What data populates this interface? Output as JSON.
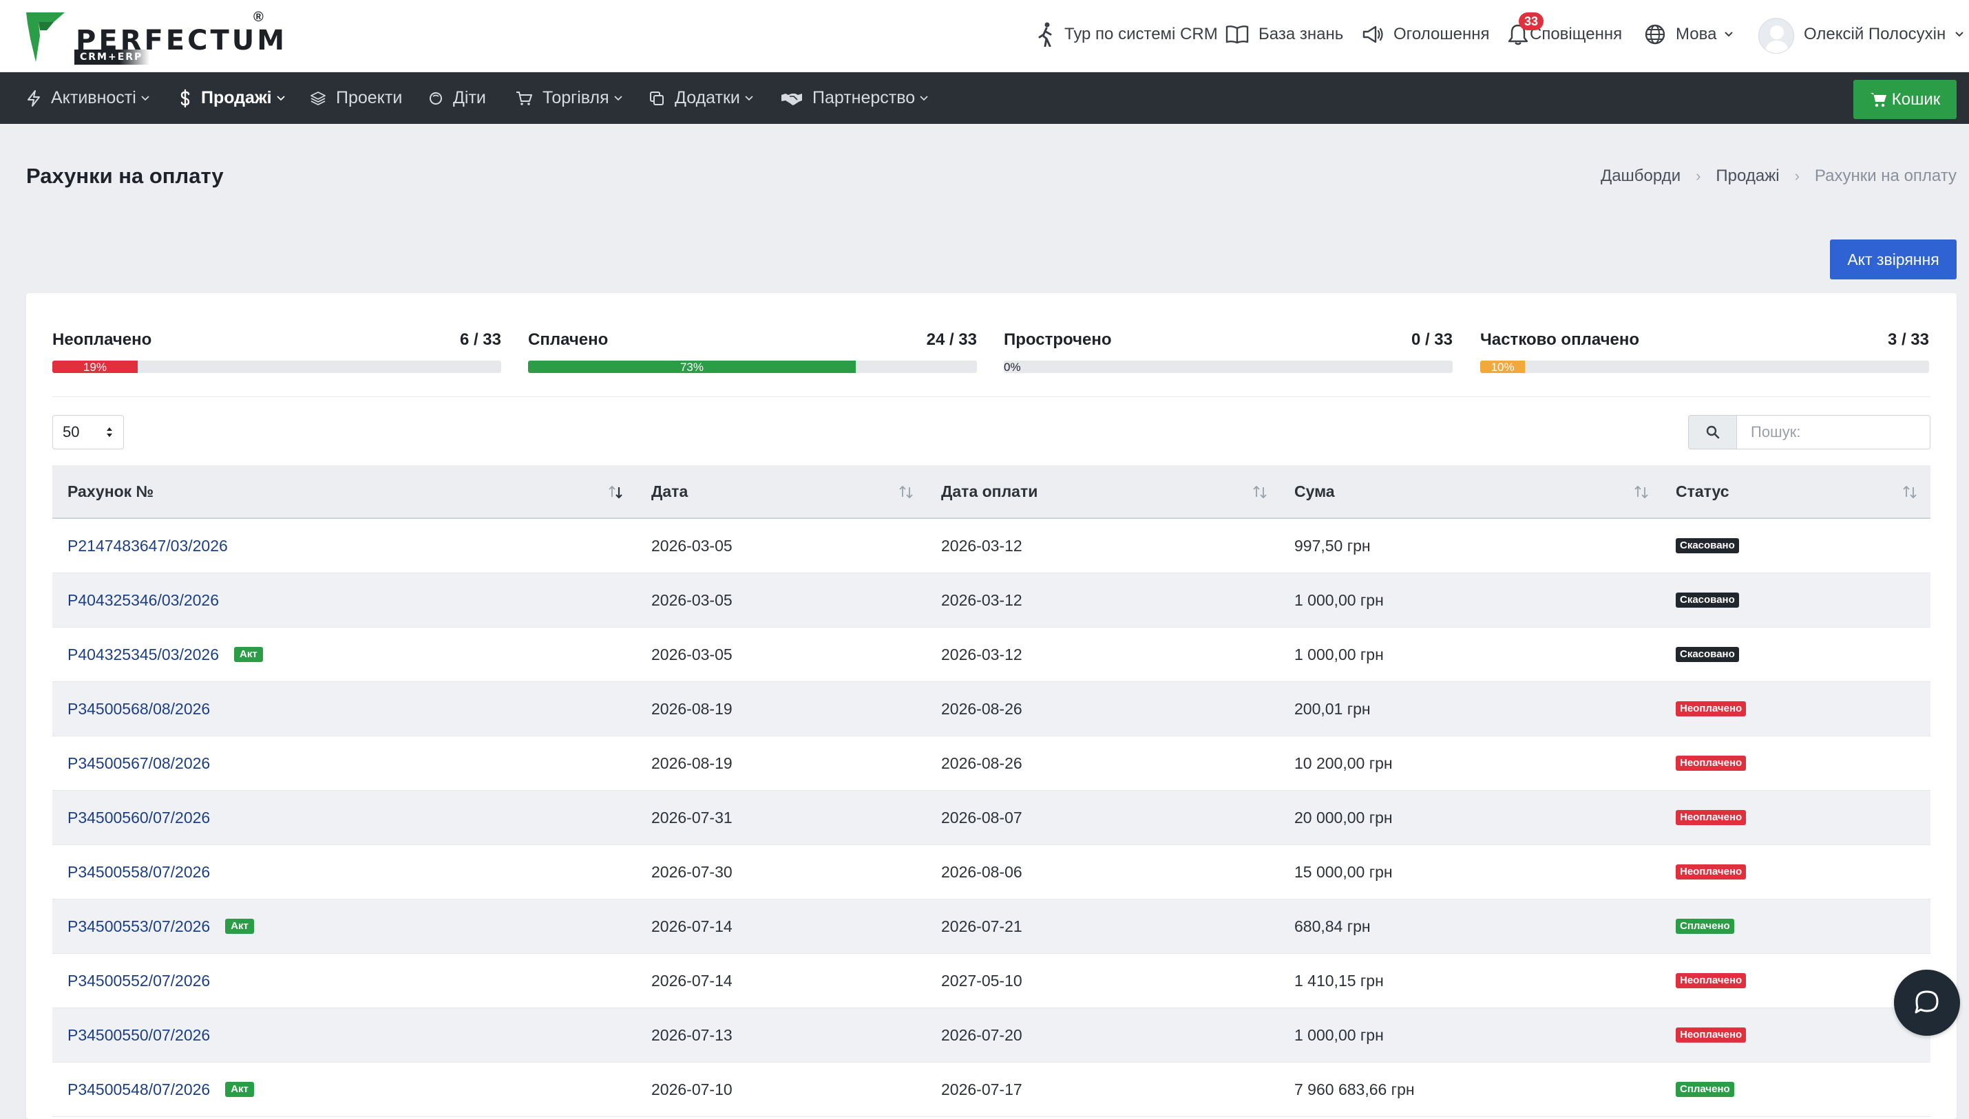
{
  "brand": {
    "name": "PERFECTUM",
    "sub": "CRM+ERP",
    "reg": "®",
    "accent": "#2a9d46"
  },
  "topnav": {
    "tour": "Тур по системі CRM",
    "knowledge": "База знань",
    "announcements": "Оголошення",
    "notifications": "Сповіщення",
    "notifications_count": "33",
    "language": "Мова",
    "user": "Олексій Полосухін"
  },
  "mainnav": {
    "items": [
      {
        "label": "Активності",
        "icon": "lightning-icon"
      },
      {
        "label": "Продажі",
        "icon": "dollar-icon"
      },
      {
        "label": "Проекти",
        "icon": "layers-icon"
      },
      {
        "label": "Діти",
        "icon": "circle-icon"
      },
      {
        "label": "Торгівля",
        "icon": "cart-icon"
      },
      {
        "label": "Додатки",
        "icon": "copy-icon"
      },
      {
        "label": "Партнерство",
        "icon": "handshake-icon"
      }
    ],
    "cart": "Кошик"
  },
  "page": {
    "title": "Рахунки на оплату",
    "breadcrumb": [
      "Дашборди",
      "Продажі",
      "Рахунки на оплату"
    ],
    "act_button": "Акт звіряння"
  },
  "stats": [
    {
      "label": "Неоплачено",
      "count": "6 / 33",
      "percent": 19,
      "percent_label": "19%",
      "color": "#e0303e"
    },
    {
      "label": "Сплачено",
      "count": "24 / 33",
      "percent": 73,
      "percent_label": "73%",
      "color": "#2a9d46"
    },
    {
      "label": "Прострочено",
      "count": "0 / 33",
      "percent": 0,
      "percent_label": "0%",
      "color": "#e0303e"
    },
    {
      "label": "Частково оплачено",
      "count": "3 / 33",
      "percent": 10,
      "percent_label": "10%",
      "color": "#f2a83b"
    }
  ],
  "controls": {
    "page_size": "50",
    "search_placeholder": "Пошук:"
  },
  "table": {
    "columns": [
      "Рахунок №",
      "Дата",
      "Дата оплати",
      "Сума",
      "Статус"
    ],
    "act_badge": "Акт",
    "status_colors": {
      "Скасовано": "#22272d",
      "Неоплачено": "#e0303e",
      "Сплачено": "#2a9d46"
    },
    "rows": [
      {
        "number": "Р2147483647/03/2026",
        "date": "2026-03-05",
        "pay_date": "2026-03-12",
        "sum": "997,50 грн",
        "status": "Скасовано",
        "act": false
      },
      {
        "number": "Р404325346/03/2026",
        "date": "2026-03-05",
        "pay_date": "2026-03-12",
        "sum": "1 000,00 грн",
        "status": "Скасовано",
        "act": false
      },
      {
        "number": "Р404325345/03/2026",
        "date": "2026-03-05",
        "pay_date": "2026-03-12",
        "sum": "1 000,00 грн",
        "status": "Скасовано",
        "act": true
      },
      {
        "number": "Р34500568/08/2026",
        "date": "2026-08-19",
        "pay_date": "2026-08-26",
        "sum": "200,01 грн",
        "status": "Неоплачено",
        "act": false
      },
      {
        "number": "Р34500567/08/2026",
        "date": "2026-08-19",
        "pay_date": "2026-08-26",
        "sum": "10 200,00 грн",
        "status": "Неоплачено",
        "act": false
      },
      {
        "number": "Р34500560/07/2026",
        "date": "2026-07-31",
        "pay_date": "2026-08-07",
        "sum": "20 000,00 грн",
        "status": "Неоплачено",
        "act": false
      },
      {
        "number": "Р34500558/07/2026",
        "date": "2026-07-30",
        "pay_date": "2026-08-06",
        "sum": "15 000,00 грн",
        "status": "Неоплачено",
        "act": false
      },
      {
        "number": "Р34500553/07/2026",
        "date": "2026-07-14",
        "pay_date": "2026-07-21",
        "sum": "680,84 грн",
        "status": "Сплачено",
        "act": true
      },
      {
        "number": "Р34500552/07/2026",
        "date": "2026-07-14",
        "pay_date": "2027-05-10",
        "sum": "1 410,15 грн",
        "status": "Неоплачено",
        "act": false
      },
      {
        "number": "Р34500550/07/2026",
        "date": "2026-07-13",
        "pay_date": "2026-07-20",
        "sum": "1 000,00 грн",
        "status": "Неоплачено",
        "act": false
      },
      {
        "number": "Р34500548/07/2026",
        "date": "2026-07-10",
        "pay_date": "2026-07-17",
        "sum": "7 960 683,66 грн",
        "status": "Сплачено",
        "act": true
      }
    ]
  }
}
